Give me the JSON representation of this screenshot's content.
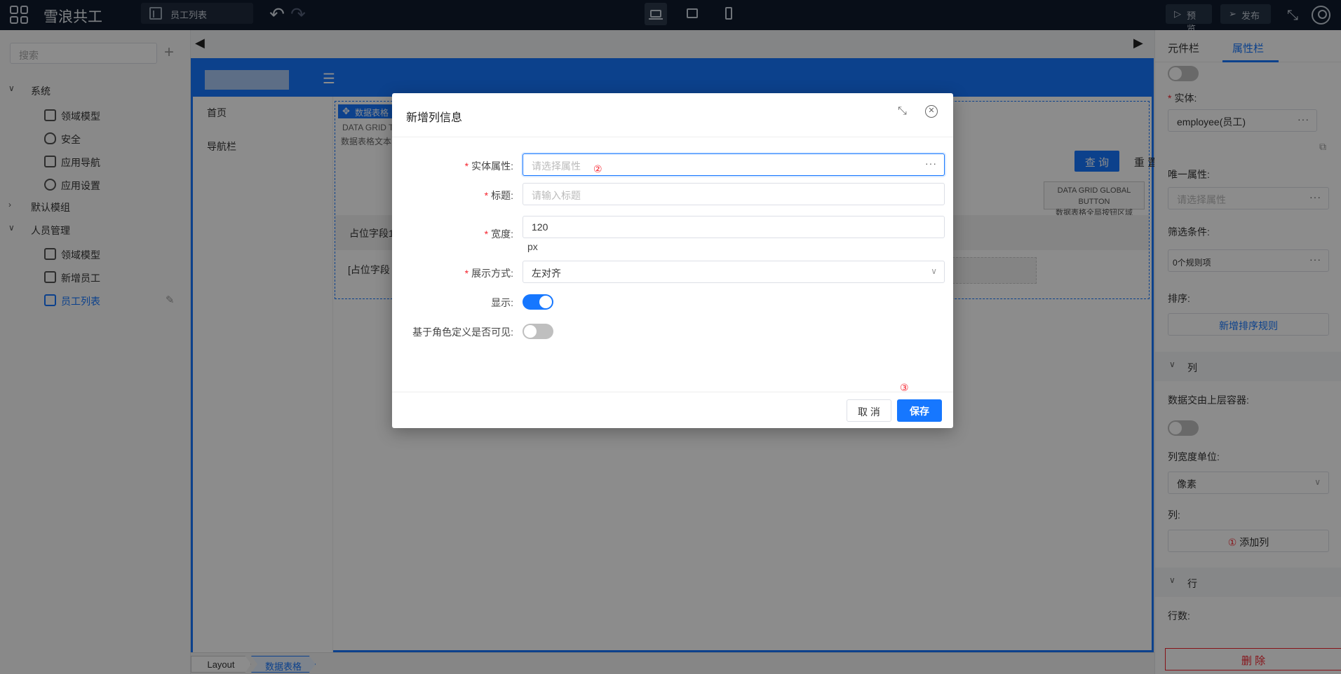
{
  "app": {
    "title": "雪浪共工"
  },
  "topbar": {
    "page_name": "员工列表",
    "preview_label": "预览",
    "publish_label": "发布"
  },
  "sidebar": {
    "search_placeholder": "搜索",
    "groups": [
      {
        "label": "系统",
        "items": [
          "领域模型",
          "安全",
          "应用导航",
          "应用设置"
        ]
      },
      {
        "label": "默认模组",
        "items": []
      },
      {
        "label": "人员管理",
        "items": [
          "领域模型",
          "新增员工",
          "员工列表"
        ]
      }
    ],
    "selected_item": "员工列表"
  },
  "canvas": {
    "nav_items": [
      "首页",
      "导航栏"
    ],
    "grid_tag": "数据表格",
    "grid_sub1": "DATA GRID T",
    "grid_sub2": "数据表格文本",
    "query_label": "查 询",
    "reset_label": "重 置",
    "global_button_en": "DATA GRID GLOBAL BUTTON",
    "global_button_zh": "数据表格全局按钮区域",
    "col_placeholder1": "占位字段1",
    "col_placeholder2": "[占位字段"
  },
  "breadcrumb": [
    "Layout",
    "数据表格"
  ],
  "right_panel": {
    "tabs": [
      "元件栏",
      "属性栏"
    ],
    "active_tab": "属性栏",
    "entity_label": "实体:",
    "entity_value": "employee(员工)",
    "unique_label": "唯一属性:",
    "unique_placeholder": "请选择属性",
    "filter_label": "筛选条件:",
    "filter_value": "0个规则项",
    "sort_label": "排序:",
    "add_sort_label": "新增排序规则",
    "column_section": "列",
    "data_from_parent_label": "数据交由上层容器:",
    "col_width_unit_label": "列宽度单位:",
    "col_width_unit_value": "像素",
    "columns_label": "列:",
    "add_column_marker": "①",
    "add_column_label": "添加列",
    "row_section": "行",
    "row_count_label": "行数:",
    "delete_label": "删 除"
  },
  "modal": {
    "title": "新增列信息",
    "fields": {
      "entity_attr_label": "实体属性:",
      "entity_attr_placeholder": "请选择属性",
      "entity_attr_marker": "②",
      "title_label": "标题:",
      "title_placeholder": "请输入标题",
      "width_label": "宽度:",
      "width_value": "120",
      "width_unit": "px",
      "display_mode_label": "展示方式:",
      "display_mode_value": "左对齐",
      "visible_label": "显示:",
      "visible_on": true,
      "role_based_label": "基于角色定义是否可见:",
      "role_based_on": false
    },
    "save_marker": "③",
    "cancel_label": "取 消",
    "save_label": "保存"
  },
  "colors": {
    "primary": "#1677ff",
    "topbar": "#0f1b2c",
    "danger": "#f5222d"
  }
}
